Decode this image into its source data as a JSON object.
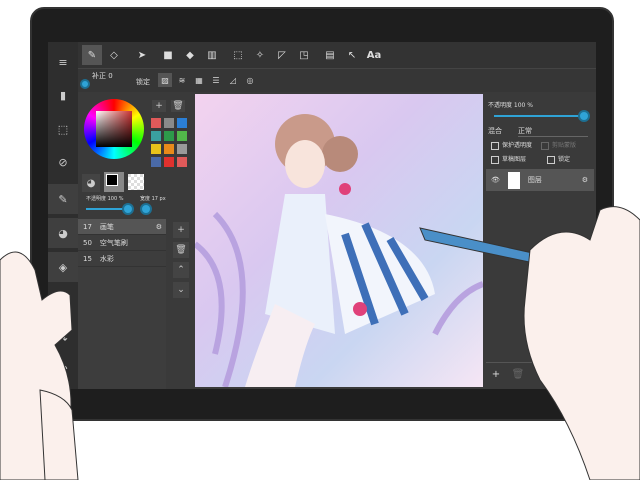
{
  "toolbar": {
    "text_tool": "Aa"
  },
  "subbar": {
    "correction_label": "补正 0",
    "lock_label": "锁定"
  },
  "brush": {
    "opacity_label": "不透明度 100 %",
    "opacity": 100,
    "width_label": "宽度 17 px",
    "width": 17,
    "list": [
      {
        "size": "17",
        "name": "画笔",
        "selected": true
      },
      {
        "size": "50",
        "name": "空气笔刷"
      },
      {
        "size": "15",
        "name": "水彩"
      }
    ]
  },
  "colors": {
    "accent": "#2fa3d6",
    "palette": [
      "#e05a5a",
      "#8a8a8a",
      "#2b7fd6",
      "#3aa0a0",
      "#2d9a4a",
      "#52b84a",
      "#e8c21a",
      "#e88a1a",
      "#9a9a9a",
      "#4a6aa8",
      "#e0312e",
      "#e05a5a"
    ]
  },
  "layers": {
    "opacity_label": "不透明度 100 %",
    "opacity": 100,
    "blend_label": "混合",
    "blend_value": "正常",
    "protect_alpha": "保护透明度",
    "clipping": "剪贴蒙版",
    "draft": "草稿图层",
    "lock": "锁定",
    "items": [
      {
        "name": "图层",
        "visible": true
      }
    ]
  }
}
